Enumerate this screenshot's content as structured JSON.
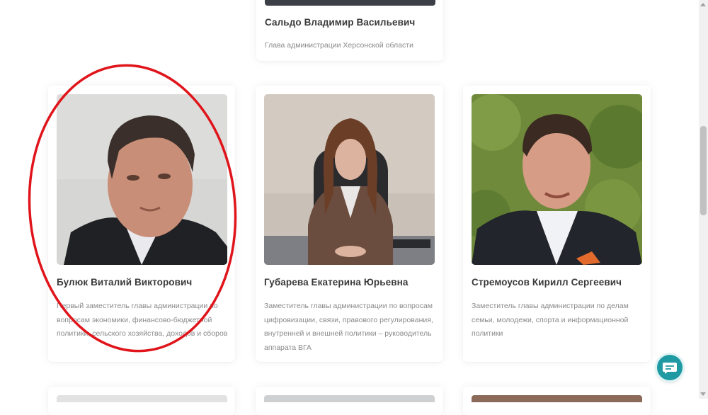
{
  "cards": {
    "top": {
      "name": "Сальдо Владимир Васильевич",
      "role": "Глава администрации Херсонской области"
    },
    "row": [
      {
        "name": "Булюк Виталий Викторович",
        "role": "Первый заместитель главы администрации по вопросам экономики, финансово-бюджетной политики, сельского хозяйства, доходов и сборов"
      },
      {
        "name": "Губарева Екатерина Юрьевна",
        "role": "Заместитель главы администрации по вопросам цифровизации, связи, правового регулирования, внутренней и внешней политики – руководитель аппарата ВГА"
      },
      {
        "name": "Стремоусов Кирилл Сергеевич",
        "role": "Заместитель главы администрации по делам семьи, молодежи, спорта и информационной политики"
      }
    ]
  },
  "colors": {
    "annotation_ellipse": "#e0141b",
    "chat_button": "#1f9aa3"
  },
  "icons": {
    "chat": "chat-bubble-icon"
  }
}
